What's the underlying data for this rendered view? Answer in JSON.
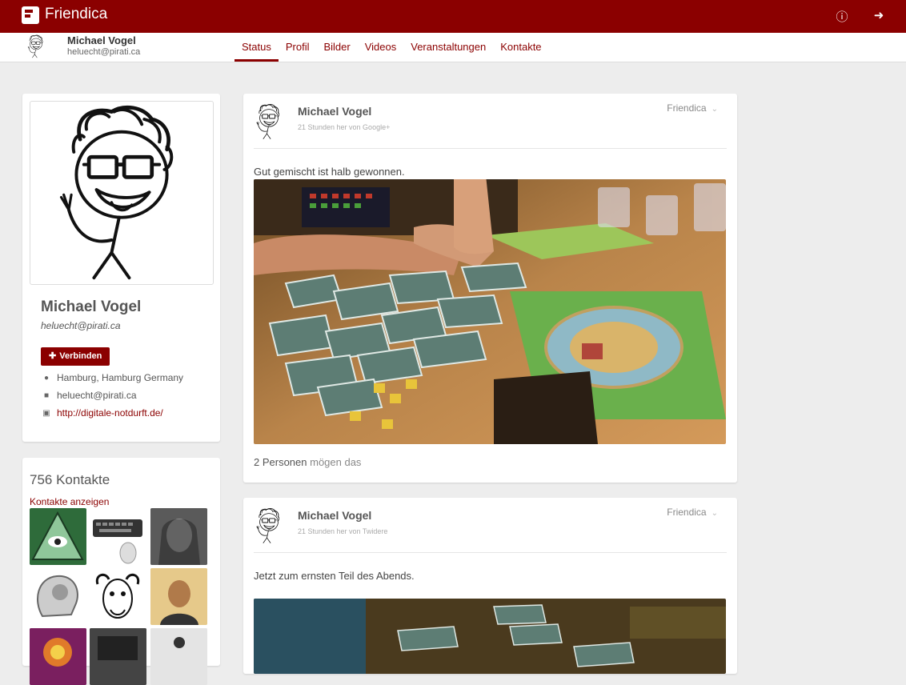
{
  "app": {
    "title": "Friendica"
  },
  "topbar": {
    "icons": [
      "info-icon",
      "sign-in-icon"
    ]
  },
  "user": {
    "name": "Michael Vogel",
    "address": "heluecht@pirati.ca"
  },
  "tabs": [
    {
      "label": "Status",
      "active": true
    },
    {
      "label": "Profil"
    },
    {
      "label": "Bilder"
    },
    {
      "label": "Videos"
    },
    {
      "label": "Veranstaltungen"
    },
    {
      "label": "Kontakte"
    }
  ],
  "profile": {
    "name": "Michael Vogel",
    "address": "heluecht@pirati.ca",
    "connect_label": "Verbinden",
    "location": "Hamburg, Hamburg Germany",
    "chat": "heluecht@pirati.ca",
    "homepage": "http://digitale-notdurft.de/"
  },
  "contacts": {
    "title": "756 Kontakte",
    "link": "Kontakte anzeigen",
    "thumbs": [
      "illuminati-eye",
      "keyboard-mouse",
      "woman-portrait",
      "head-xray",
      "gnu",
      "man-portrait",
      "colorful-art",
      "dark-box",
      "person-portrait"
    ]
  },
  "posts": [
    {
      "author": "Michael Vogel",
      "meta": "21 Stunden her von Google+",
      "network": "Friendica",
      "text": "Gut gemischt ist halb gewonnen.",
      "likes_count": "2 Personen",
      "likes_suffix": " mögen das"
    },
    {
      "author": "Michael Vogel",
      "meta": "21 Stunden her von Twidere",
      "network": "Friendica",
      "text": "Jetzt zum ernsten Teil des Abends."
    }
  ],
  "colors": {
    "accent": "#8b0000",
    "background": "#ededed"
  }
}
